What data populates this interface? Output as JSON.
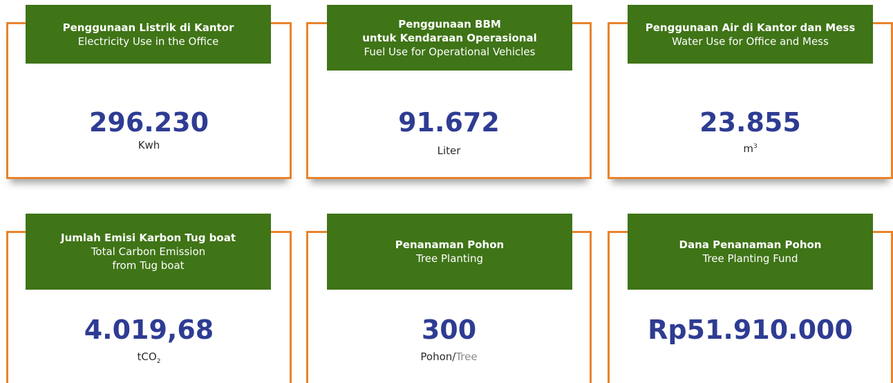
{
  "colors": {
    "border": "#e9832b",
    "label_bg": "#3f7417",
    "value_text": "#2e3c93"
  },
  "cards": [
    {
      "title_id": "Penggunaan Listrik di Kantor",
      "title_en": "Electricity Use in the Office",
      "value": "296.230",
      "unit": "Kwh"
    },
    {
      "title_id_line1": "Penggunaan BBM",
      "title_id_line2": "untuk Kendaraan Operasional",
      "title_en": "Fuel Use for Operational Vehicles",
      "value": "91.672",
      "unit": "Liter"
    },
    {
      "title_id": "Penggunaan Air di Kantor dan Mess",
      "title_en": "Water Use for Office and Mess",
      "value": "23.855",
      "unit_base": "m",
      "unit_sup": "3"
    },
    {
      "title_id": "Jumlah Emisi Karbon Tug boat",
      "title_en_line1": "Total Carbon Emission",
      "title_en_line2": "from Tug boat",
      "value": "4.019,68",
      "unit_base": "tCO",
      "unit_sub": "2"
    },
    {
      "title_id": "Penanaman Pohon",
      "title_en": "Tree Planting",
      "value": "300",
      "unit_main": "Pohon/",
      "unit_muted": "Tree"
    },
    {
      "title_id": "Dana Penanaman Pohon",
      "title_en": "Tree Planting Fund",
      "value": "Rp51.910.000"
    }
  ]
}
